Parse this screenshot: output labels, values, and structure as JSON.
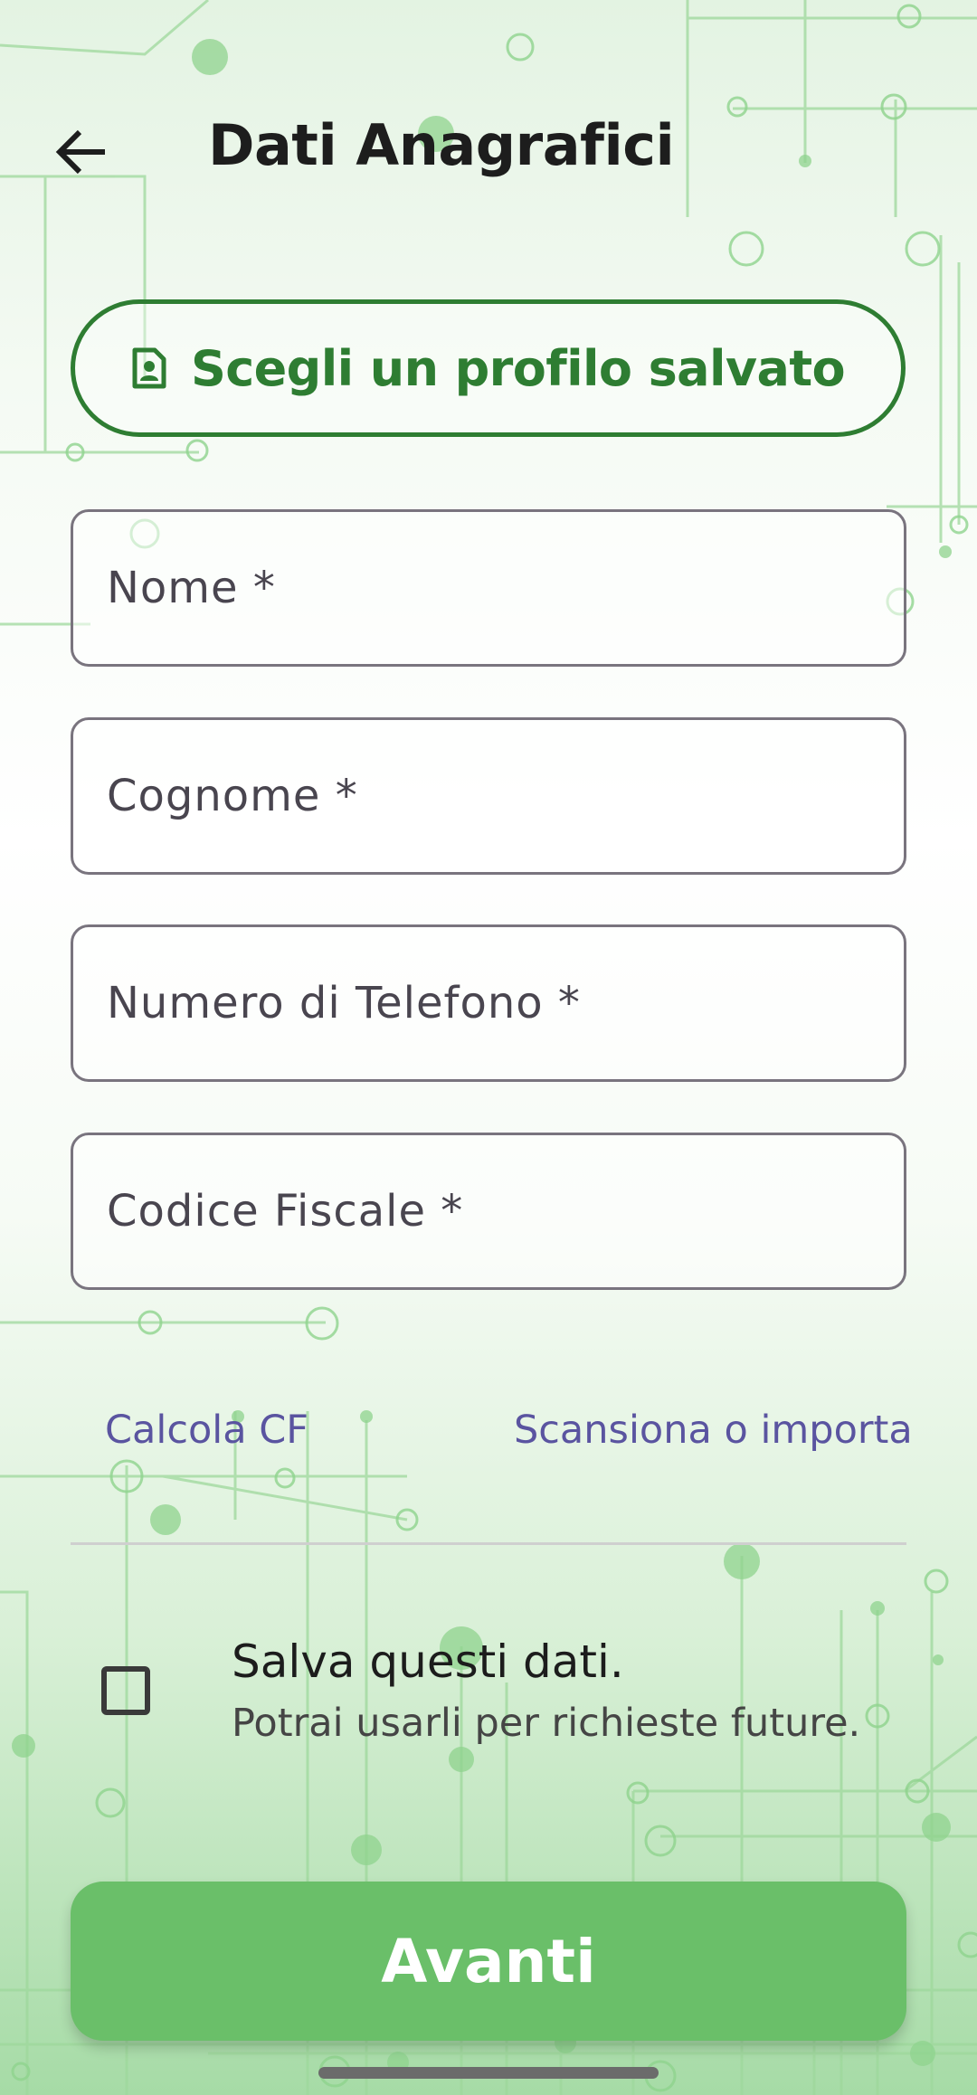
{
  "header": {
    "title": "Dati Anagrafici",
    "back_icon": "arrow-left-icon"
  },
  "profile_button": {
    "label": "Scegli un profilo salvato",
    "icon": "contact-card-icon"
  },
  "form": {
    "fields": [
      {
        "placeholder": "Nome *",
        "value": ""
      },
      {
        "placeholder": "Cognome *",
        "value": ""
      },
      {
        "placeholder": "Numero di Telefono *",
        "value": ""
      },
      {
        "placeholder": "Codice Fiscale *",
        "value": ""
      }
    ],
    "links": {
      "calc_cf": "Calcola CF",
      "scan_import": "Scansiona o importa"
    }
  },
  "save_option": {
    "title": "Salva questi dati.",
    "subtitle": "Potrai usarli per richieste future.",
    "checked": false
  },
  "next_button": {
    "label": "Avanti"
  },
  "colors": {
    "primary": "#2e7d32",
    "button_fill": "#6abf69",
    "link": "#5a54a0",
    "field_border": "#79747e"
  }
}
